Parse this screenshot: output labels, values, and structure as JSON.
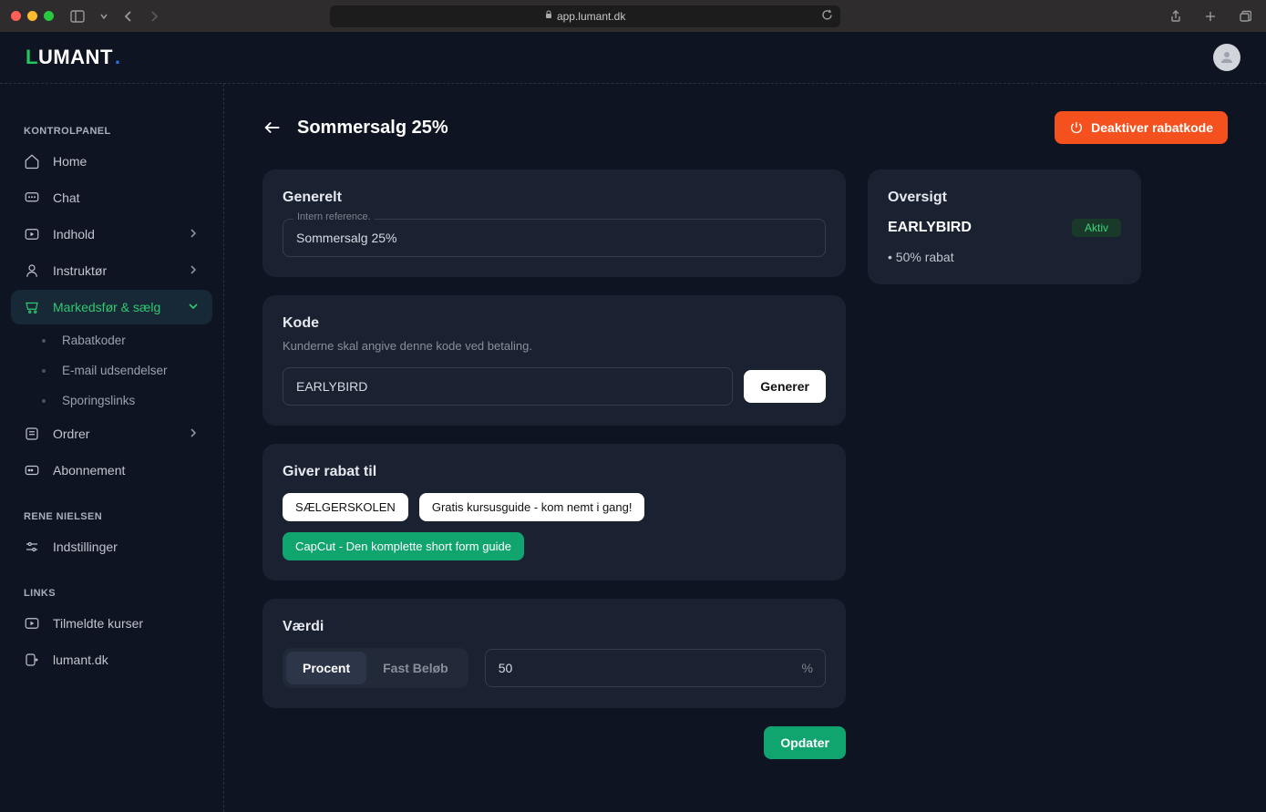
{
  "chrome": {
    "url": "app.lumant.dk"
  },
  "logo": {
    "l": "L",
    "rest": "UMANT",
    "dot": "."
  },
  "sidebar": {
    "sections": {
      "kontrolpanel": "KONTROLPANEL",
      "user": "RENE NIELSEN",
      "links": "LINKS"
    },
    "items": {
      "home": "Home",
      "chat": "Chat",
      "indhold": "Indhold",
      "instruktor": "Instruktør",
      "markedsfor": "Markedsfør & sælg",
      "rabatkoder": "Rabatkoder",
      "email": "E-mail udsendelser",
      "sporing": "Sporingslinks",
      "ordrer": "Ordrer",
      "abonnement": "Abonnement",
      "indstillinger": "Indstillinger",
      "tilmeldte": "Tilmeldte kurser",
      "lumant": "lumant.dk"
    }
  },
  "page": {
    "title": "Sommersalg 25%",
    "deactivate": "Deaktiver rabatkode",
    "update": "Opdater"
  },
  "generelt": {
    "title": "Generelt",
    "label": "Intern reference.",
    "value": "Sommersalg 25%"
  },
  "kode": {
    "title": "Kode",
    "subtitle": "Kunderne skal angive denne kode ved betaling.",
    "value": "EARLYBIRD",
    "generate": "Generer"
  },
  "rabat_til": {
    "title": "Giver rabat til",
    "tags": [
      "SÆLGERSKOLEN",
      "Gratis kursusguide - kom nemt i gang!",
      "CapCut - Den komplette short form guide"
    ]
  },
  "vaerdi": {
    "title": "Værdi",
    "procent": "Procent",
    "fast": "Fast Beløb",
    "value": "50",
    "suffix": "%"
  },
  "oversigt": {
    "title": "Oversigt",
    "code": "EARLYBIRD",
    "badge": "Aktiv",
    "line": "• 50% rabat"
  }
}
